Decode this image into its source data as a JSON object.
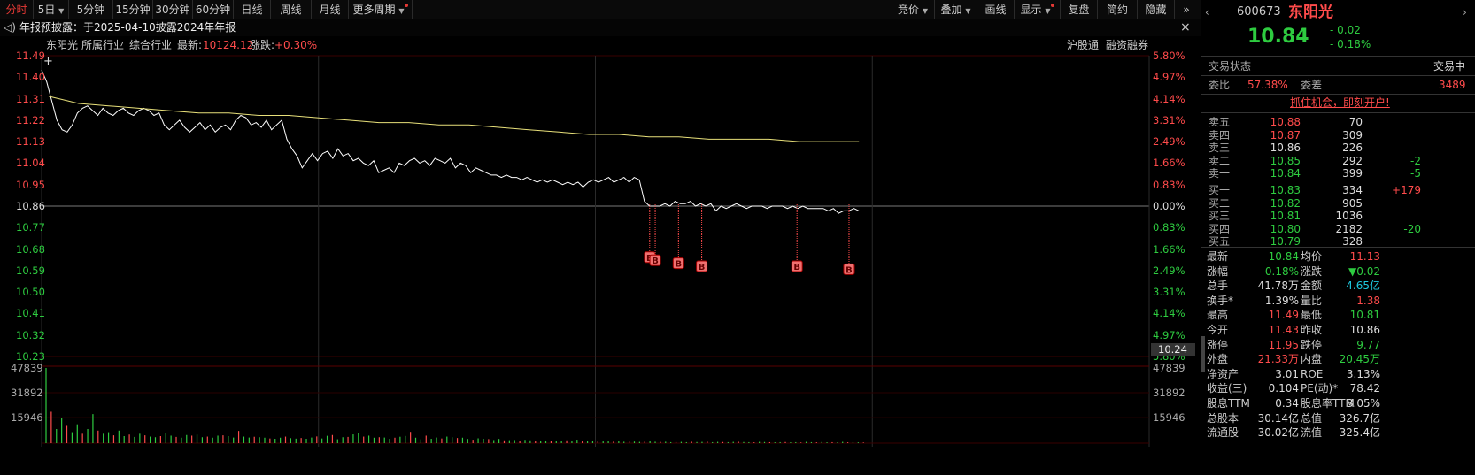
{
  "toolbar": {
    "left_tabs": [
      "分时",
      "5日",
      "5分钟",
      "15分钟",
      "30分钟",
      "60分钟",
      "日线",
      "周线",
      "月线",
      "更多周期"
    ],
    "right_tabs": [
      "竞价",
      "叠加",
      "画线",
      "显示",
      "复盘",
      "简约",
      "隐藏"
    ],
    "nav_symbol": "»"
  },
  "notice": {
    "text": "年报预披露：于2025-04-10披露2024年年报",
    "close": "×"
  },
  "info": {
    "name": "东阳光",
    "industry_label": "所属行业",
    "industry": "综合行业",
    "latest_label": "最新:",
    "latest_value": "10124.12",
    "change_label": "涨跌:",
    "change_value": "+0.30%",
    "badges": [
      "沪股通",
      "融资融券"
    ]
  },
  "colors": {
    "up": "#ff4b4b",
    "down": "#2ecc40",
    "price_line": "#ffffff",
    "avg_line": "#e8e07a",
    "cyan": "#1ec8e0",
    "grid": "#3a0000"
  },
  "chart_data": {
    "type": "line",
    "prev_close": 10.86,
    "ylim": [
      10.23,
      11.49
    ],
    "price_ticks": [
      "11.49",
      "11.40",
      "11.31",
      "11.22",
      "11.13",
      "11.04",
      "10.95",
      "10.86",
      "10.77",
      "10.68",
      "10.59",
      "10.50",
      "10.41",
      "10.32",
      "10.23"
    ],
    "pct_ticks": [
      "5.80%",
      "4.97%",
      "4.14%",
      "3.31%",
      "2.49%",
      "1.66%",
      "0.83%",
      "0.00%",
      "0.83%",
      "1.66%",
      "2.49%",
      "3.31%",
      "4.14%",
      "4.97%",
      "5.80%"
    ],
    "cursor_price": "10.24",
    "volume_ticks": [
      "47839",
      "31892",
      "15946"
    ],
    "series": [
      {
        "name": "价格",
        "values": [
          11.43,
          11.38,
          11.3,
          11.22,
          11.18,
          11.17,
          11.2,
          11.25,
          11.27,
          11.28,
          11.26,
          11.24,
          11.27,
          11.25,
          11.24,
          11.26,
          11.27,
          11.25,
          11.24,
          11.26,
          11.27,
          11.26,
          11.24,
          11.25,
          11.2,
          11.18,
          11.2,
          11.22,
          11.19,
          11.17,
          11.19,
          11.21,
          11.18,
          11.2,
          11.17,
          11.19,
          11.2,
          11.18,
          11.22,
          11.24,
          11.23,
          11.2,
          11.21,
          11.19,
          11.22,
          11.18,
          11.2,
          11.22,
          11.14,
          11.1,
          11.07,
          11.02,
          11.05,
          11.08,
          11.05,
          11.08,
          11.09,
          11.06,
          11.1,
          11.07,
          11.08,
          11.05,
          11.06,
          11.04,
          11.03,
          11.05,
          11.0,
          11.01,
          11.02,
          11.0,
          11.04,
          11.03,
          11.05,
          11.06,
          11.04,
          11.05,
          11.03,
          11.06,
          11.05,
          11.04,
          11.06,
          11.02,
          11.04,
          11.03,
          11.0,
          11.02,
          11.01,
          11.0,
          10.99,
          10.99,
          10.98,
          10.99,
          10.98,
          10.98,
          10.97,
          10.98,
          10.97,
          10.96,
          10.97,
          10.96,
          10.97,
          10.96,
          10.95,
          10.96,
          10.95,
          10.96,
          10.94,
          10.96,
          10.97,
          10.96,
          10.97,
          10.98,
          10.96,
          10.97,
          10.98,
          10.96,
          10.98,
          10.97,
          10.88,
          10.86,
          10.86,
          10.86,
          10.87,
          10.86,
          10.88,
          10.87,
          10.87,
          10.88,
          10.86,
          10.87,
          10.86,
          10.87,
          10.84,
          10.86,
          10.85,
          10.86,
          10.87,
          10.86,
          10.85,
          10.86,
          10.86,
          10.86,
          10.85,
          10.86,
          10.86,
          10.86,
          10.85,
          10.86,
          10.85,
          10.86,
          10.85,
          10.85,
          10.85,
          10.85,
          10.84,
          10.85,
          10.83,
          10.84,
          10.84,
          10.85,
          10.84
        ]
      },
      {
        "name": "均价",
        "values": [
          11.32,
          11.29,
          11.28,
          11.27,
          11.26,
          11.25,
          11.25,
          11.24,
          11.24,
          11.23,
          11.22,
          11.21,
          11.21,
          11.2,
          11.2,
          11.19,
          11.18,
          11.17,
          11.16,
          11.16,
          11.15,
          11.15,
          11.14,
          11.14,
          11.14,
          11.13,
          11.13,
          11.13
        ]
      }
    ],
    "markers": [
      "B",
      "B",
      "B",
      "B",
      "B",
      "B"
    ],
    "volume_values": [
      47839,
      20000,
      9000,
      16000,
      11000,
      7000,
      12000,
      6000,
      9000,
      18500,
      8000,
      6000,
      7000,
      5000,
      8000,
      4500,
      5500,
      4000,
      6000,
      5000,
      4200,
      3800,
      4500,
      6200,
      4800,
      4000,
      3500,
      5200,
      4800,
      5500,
      3800,
      4200,
      3500,
      4800,
      5000,
      4500,
      3600,
      7800,
      4200,
      3600,
      4100,
      3800,
      3500,
      3000,
      2800,
      3500,
      4200,
      3200,
      2900,
      3300,
      2800,
      3600,
      4300,
      3000,
      4700,
      5200,
      2500,
      3800,
      4000,
      5600,
      6300,
      4200,
      4800,
      3500,
      3800,
      3600,
      2800,
      3500,
      4100,
      4600,
      7200,
      3500,
      2500,
      4800,
      2800,
      3600,
      3000,
      4200,
      3800,
      3300,
      3500,
      2700,
      2200,
      3100,
      2800,
      2600,
      2000,
      2700,
      1800,
      1900,
      2000,
      1600,
      2100,
      1800,
      1500,
      1700,
      1600,
      1400,
      1200,
      1500,
      1800,
      1600,
      2200,
      1400,
      1200,
      1600,
      1300,
      1100,
      1200,
      1000,
      1300,
      900,
      1100,
      1000,
      800,
      1000,
      1200,
      900,
      800,
      900,
      600,
      700,
      800,
      600,
      900,
      700,
      800,
      1000,
      600,
      800,
      700,
      600,
      800,
      900,
      700,
      600,
      500,
      800,
      700,
      600,
      500,
      600,
      700,
      500,
      600,
      400,
      800,
      600,
      500,
      700,
      500,
      600,
      400,
      800,
      500,
      600,
      500,
      400
    ]
  },
  "panel": {
    "code": "600673",
    "name": "东阳光",
    "price": "10.84",
    "change": "- 0.02",
    "change_pct": "- 0.18%",
    "status_label": "交易状态",
    "status_value": "交易中",
    "weibi_label": "委比",
    "weibi_value": "57.38%",
    "weicha_label": "委差",
    "weicha_value": "3489",
    "promo": "抓住机会，即刻开户!",
    "asks": [
      {
        "label": "卖五",
        "price": "10.88",
        "vol": "70",
        "chg": ""
      },
      {
        "label": "卖四",
        "price": "10.87",
        "vol": "309",
        "chg": ""
      },
      {
        "label": "卖三",
        "price": "10.86",
        "vol": "226",
        "chg": ""
      },
      {
        "label": "卖二",
        "price": "10.85",
        "vol": "292",
        "chg": "-2"
      },
      {
        "label": "卖一",
        "price": "10.84",
        "vol": "399",
        "chg": "-5"
      }
    ],
    "bids": [
      {
        "label": "买一",
        "price": "10.83",
        "vol": "334",
        "chg": "+179"
      },
      {
        "label": "买二",
        "price": "10.82",
        "vol": "905",
        "chg": ""
      },
      {
        "label": "买三",
        "price": "10.81",
        "vol": "1036",
        "chg": ""
      },
      {
        "label": "买四",
        "price": "10.80",
        "vol": "2182",
        "chg": "-20"
      },
      {
        "label": "买五",
        "price": "10.79",
        "vol": "328",
        "chg": ""
      }
    ],
    "stats": [
      {
        "l1": "最新",
        "v1": "10.84",
        "c1": "green",
        "l2": "均价",
        "v2": "11.13",
        "c2": "red"
      },
      {
        "l1": "涨幅",
        "v1": "-0.18%",
        "c1": "green",
        "l2": "涨跌",
        "v2": "▼0.02",
        "c2": "green"
      },
      {
        "l1": "总手",
        "v1": "41.78万",
        "c1": "white",
        "l2": "金额",
        "v2": "4.65亿",
        "c2": "cyan"
      },
      {
        "l1": "换手*",
        "v1": "1.39%",
        "c1": "white",
        "l2": "量比",
        "v2": "1.38",
        "c2": "red"
      },
      {
        "l1": "最高",
        "v1": "11.49",
        "c1": "red",
        "l2": "最低",
        "v2": "10.81",
        "c2": "green"
      },
      {
        "l1": "今开",
        "v1": "11.43",
        "c1": "red",
        "l2": "昨收",
        "v2": "10.86",
        "c2": "white"
      },
      {
        "l1": "涨停",
        "v1": "11.95",
        "c1": "red",
        "l2": "跌停",
        "v2": "9.77",
        "c2": "green"
      },
      {
        "l1": "外盘",
        "v1": "21.33万",
        "c1": "red",
        "l2": "内盘",
        "v2": "20.45万",
        "c2": "green"
      },
      {
        "l1": "净资产",
        "v1": "3.01",
        "c1": "white",
        "l2": "ROE",
        "v2": "3.13%",
        "c2": "white"
      },
      {
        "l1": "收益(三)",
        "v1": "0.104",
        "c1": "white",
        "l2": "PE(动)*",
        "v2": "78.42",
        "c2": "white"
      },
      {
        "l1": "股息TTM",
        "v1": "0.34",
        "c1": "white",
        "l2": "股息率TTM",
        "v2": "3.05%",
        "c2": "white"
      },
      {
        "l1": "总股本",
        "v1": "30.14亿",
        "c1": "white",
        "l2": "总值",
        "v2": "326.7亿",
        "c2": "white"
      },
      {
        "l1": "流通股",
        "v1": "30.02亿",
        "c1": "white",
        "l2": "流值",
        "v2": "325.4亿",
        "c2": "white"
      }
    ]
  }
}
